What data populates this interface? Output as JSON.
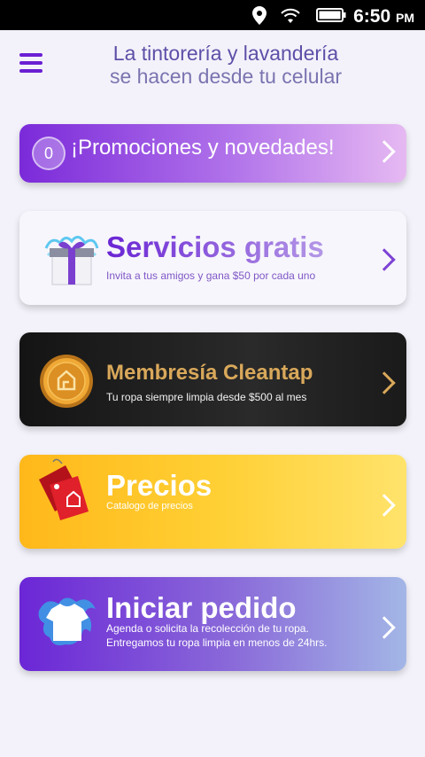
{
  "status_bar": {
    "time": "6:50",
    "ampm": "PM",
    "icons": [
      "location-icon",
      "wifi-icon",
      "battery-icon"
    ]
  },
  "header": {
    "menu_icon": "hamburger-menu-icon",
    "title_line1": "La tintorería y lavandería",
    "title_line2": "se hacen desde tu celular"
  },
  "promo_card": {
    "badge_count": "0",
    "title": "¡Promociones y novedades!"
  },
  "free_services_card": {
    "title": "Servicios gratis",
    "subtitle": "Invita a tus amigos y gana $50 por cada uno",
    "icon": "gift-box-icon"
  },
  "membership_card": {
    "title": "Membresía Cleantap",
    "subtitle": "Tu ropa siempre limpia desde $500 al mes",
    "icon": "gold-coin-icon"
  },
  "prices_card": {
    "title": "Precios",
    "subtitle": "Catalogo de precios",
    "icon": "price-tag-icon"
  },
  "order_card": {
    "title": "Iniciar pedido",
    "subtitle_line1": "Agenda o solicita la recolección de tu ropa.",
    "subtitle_line2": "Entregamos tu ropa limpia en menos de 24hrs.",
    "icon": "tshirt-splash-icon"
  },
  "colors": {
    "accent_purple": "#6a1fd3",
    "gold": "#d9a85a",
    "yellow": "#ffcf33",
    "background": "#f3f2fa"
  }
}
